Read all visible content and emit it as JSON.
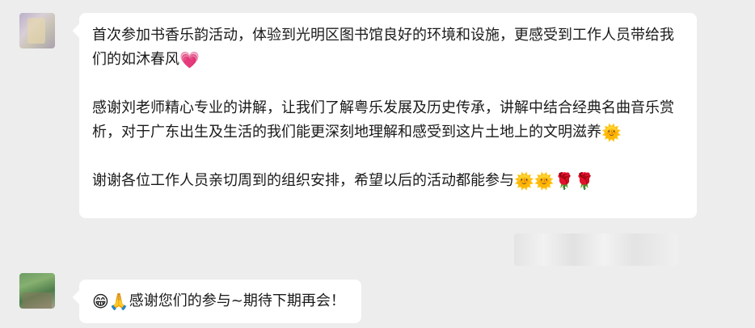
{
  "messages": [
    {
      "paragraphs": [
        {
          "text": "首次参加书香乐韵活动，体验到光明区图书馆良好的环境和设施，更感受到工作人员带给我们的如沐春风",
          "emojis": [
            "💗"
          ]
        },
        {
          "text": "感谢刘老师精心专业的讲解，让我们了解粤乐发展及历史传承，讲解中结合经典名曲音乐赏析，对于广东出生及生活的我们能更深刻地理解和感受到这片土地上的文明滋养",
          "emojis": [
            "🌞"
          ]
        },
        {
          "text": "谢谢各位工作人员亲切周到的组织安排，希望以后的活动都能参与",
          "emojis": [
            "🌞",
            "🌞",
            "🌹",
            "🌹"
          ]
        }
      ]
    },
    {
      "prefix_emojis": [
        "😁",
        "🙏"
      ],
      "text": "感谢您们的参与~期待下期再会！"
    }
  ]
}
